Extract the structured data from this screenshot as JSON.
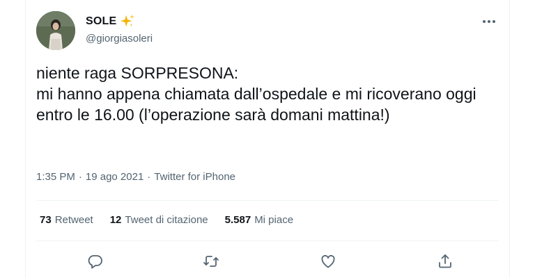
{
  "user": {
    "display_name": "SOLE",
    "handle": "@giorgiasoleri"
  },
  "tweet": {
    "text": "niente raga SORPRESONA:\nmi hanno appena chiamata dall’ospedale e mi ricoverano oggi entro le 16.00 (l’operazione sarà domani mattina!)",
    "time": "1:35 PM",
    "date": "19 ago 2021",
    "separator": "·",
    "source": "Twitter for iPhone"
  },
  "stats": {
    "retweets": {
      "count": "73",
      "label": "Retweet"
    },
    "quotes": {
      "count": "12",
      "label": "Tweet di citazione"
    },
    "likes": {
      "count": "5.587",
      "label": "Mi piace"
    }
  },
  "icons": {
    "sparkle": "sparkles-icon",
    "more": "more-options-icon",
    "reply": "reply-icon",
    "retweet": "retweet-icon",
    "like": "heart-icon",
    "share": "share-icon"
  },
  "colors": {
    "text": "#0f1419",
    "secondary": "#536471",
    "sparkle": "#f4b400",
    "divider": "#eff3f4"
  }
}
